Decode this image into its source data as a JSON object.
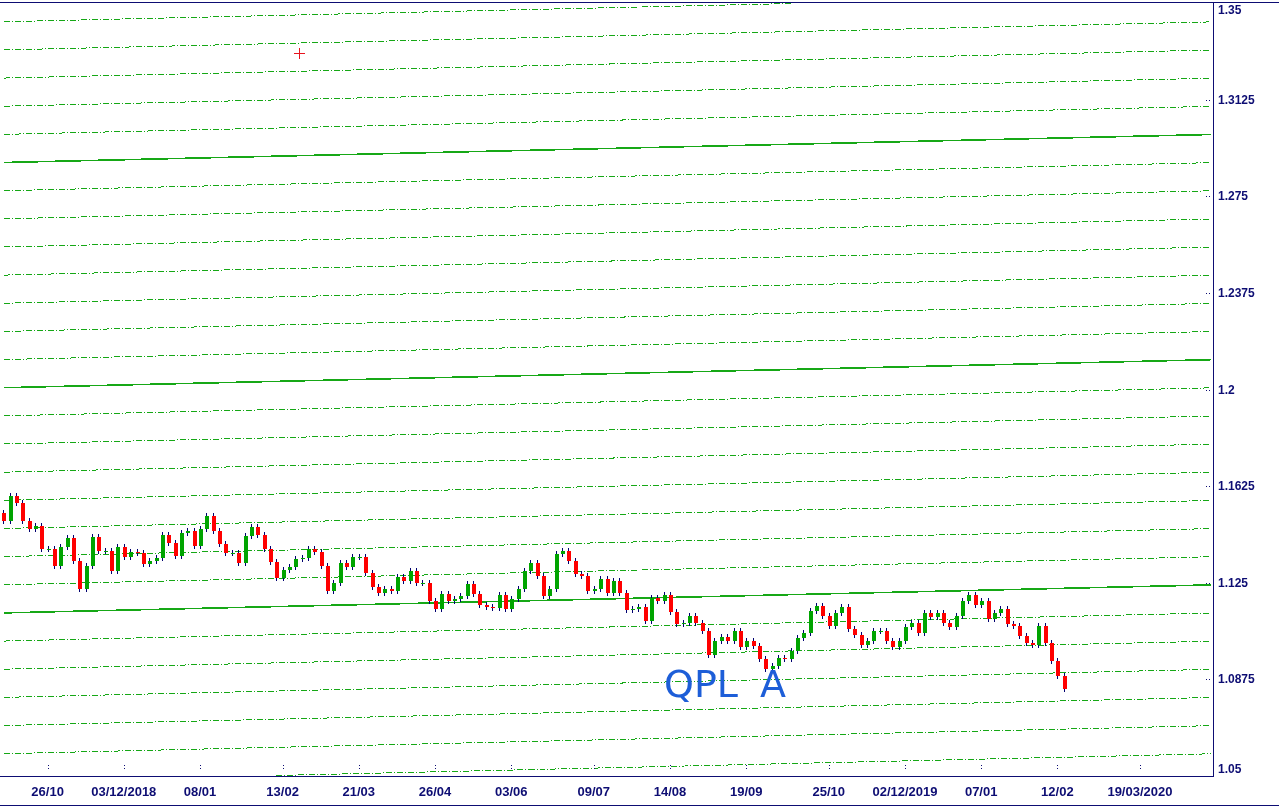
{
  "chart": {
    "chart_data": {
      "type": "candlestick",
      "ylim": [
        1.05,
        1.35
      ],
      "yticks": [
        {
          "value": 1.35,
          "label": "1.35"
        },
        {
          "value": 1.3125,
          "label": "1.3125"
        },
        {
          "value": 1.275,
          "label": "1.275"
        },
        {
          "value": 1.2375,
          "label": "1.2375"
        },
        {
          "value": 1.2,
          "label": "1.2"
        },
        {
          "value": 1.1625,
          "label": "1.1625"
        },
        {
          "value": 1.125,
          "label": "1.125"
        },
        {
          "value": 1.0875,
          "label": "1.0875"
        },
        {
          "value": 1.05,
          "label": "1.05"
        }
      ],
      "categories": [
        null,
        null,
        null,
        null,
        null,
        null,
        null,
        "26/10",
        null,
        null,
        null,
        null,
        null,
        null,
        null,
        null,
        null,
        null,
        null,
        "03/12/2018",
        null,
        null,
        null,
        null,
        null,
        null,
        null,
        null,
        null,
        null,
        null,
        "08/01",
        null,
        null,
        null,
        null,
        null,
        null,
        null,
        null,
        null,
        null,
        null,
        null,
        "13/02",
        null,
        null,
        null,
        null,
        null,
        null,
        null,
        null,
        null,
        null,
        null,
        "21/03",
        null,
        null,
        null,
        null,
        null,
        null,
        null,
        null,
        null,
        null,
        null,
        "26/04",
        null,
        null,
        null,
        null,
        null,
        null,
        null,
        null,
        null,
        null,
        null,
        "03/06",
        null,
        null,
        null,
        null,
        null,
        null,
        null,
        null,
        null,
        null,
        null,
        null,
        "09/07",
        null,
        null,
        null,
        null,
        null,
        null,
        null,
        null,
        null,
        null,
        null,
        "14/08",
        null,
        null,
        null,
        null,
        null,
        null,
        null,
        null,
        null,
        null,
        null,
        "19/09",
        null,
        null,
        null,
        null,
        null,
        null,
        null,
        null,
        null,
        null,
        null,
        null,
        "25/10",
        null,
        null,
        null,
        null,
        null,
        null,
        null,
        null,
        null,
        null,
        null,
        "02/12/2019",
        null,
        null,
        null,
        null,
        null,
        null,
        null,
        null,
        null,
        null,
        null,
        "07/01",
        null,
        null,
        null,
        null,
        null,
        null,
        null,
        null,
        null,
        null,
        null,
        "12/02",
        null,
        null,
        null,
        null,
        null,
        null,
        null,
        null,
        null,
        null,
        null,
        null,
        "19/03/2020",
        null,
        null,
        null,
        null,
        null,
        null,
        null,
        null,
        null,
        null,
        null
      ],
      "ohlc": [
        [
          1.152,
          1.1532,
          1.1477,
          1.1489
        ],
        [
          1.1489,
          1.1598,
          1.1477,
          1.1586
        ],
        [
          1.1586,
          1.1598,
          1.1547,
          1.1559
        ],
        [
          1.1559,
          1.1571,
          1.1477,
          1.1489
        ],
        [
          1.1489,
          1.1501,
          1.1446,
          1.1458
        ],
        [
          1.1458,
          1.1482,
          1.1446,
          1.147
        ],
        [
          1.147,
          1.1482,
          1.1369,
          1.1381
        ],
        [
          1.1381,
          1.1393,
          1.1369,
          1.1381
        ],
        [
          1.1381,
          1.1393,
          1.1303,
          1.1315
        ],
        [
          1.1315,
          1.14,
          1.1303,
          1.1388
        ],
        [
          1.1388,
          1.1435,
          1.1376,
          1.1423
        ],
        [
          1.1423,
          1.1435,
          1.1322,
          1.1334
        ],
        [
          1.1334,
          1.1346,
          1.1214,
          1.1226
        ],
        [
          1.1226,
          1.1327,
          1.1214,
          1.1315
        ],
        [
          1.1315,
          1.1439,
          1.1303,
          1.1427
        ],
        [
          1.1427,
          1.1439,
          1.1361,
          1.1373
        ],
        [
          1.1373,
          1.1385,
          1.1361,
          1.1373
        ],
        [
          1.1373,
          1.1385,
          1.1283,
          1.1295
        ],
        [
          1.1295,
          1.14,
          1.1283,
          1.1388
        ],
        [
          1.1388,
          1.14,
          1.1338,
          1.135
        ],
        [
          1.135,
          1.1381,
          1.1338,
          1.1369
        ],
        [
          1.1369,
          1.1381,
          1.1353,
          1.1365
        ],
        [
          1.1365,
          1.1377,
          1.1311,
          1.1323
        ],
        [
          1.1323,
          1.1346,
          1.1311,
          1.1334
        ],
        [
          1.1334,
          1.1358,
          1.1322,
          1.1346
        ],
        [
          1.1346,
          1.1447,
          1.1334,
          1.1435
        ],
        [
          1.1435,
          1.1447,
          1.1392,
          1.1404
        ],
        [
          1.1404,
          1.1416,
          1.1342,
          1.1354
        ],
        [
          1.1354,
          1.1455,
          1.1342,
          1.1443
        ],
        [
          1.1443,
          1.1463,
          1.1431,
          1.1451
        ],
        [
          1.1451,
          1.1463,
          1.138,
          1.1392
        ],
        [
          1.1392,
          1.147,
          1.138,
          1.1458
        ],
        [
          1.1458,
          1.1521,
          1.1446,
          1.1509
        ],
        [
          1.1509,
          1.1521,
          1.1439,
          1.1451
        ],
        [
          1.1451,
          1.1463,
          1.1388,
          1.14
        ],
        [
          1.14,
          1.1412,
          1.1353,
          1.1365
        ],
        [
          1.1365,
          1.1377,
          1.1353,
          1.1365
        ],
        [
          1.1365,
          1.1377,
          1.1314,
          1.1326
        ],
        [
          1.1326,
          1.1443,
          1.1314,
          1.1431
        ],
        [
          1.1431,
          1.1478,
          1.1419,
          1.1466
        ],
        [
          1.1466,
          1.1478,
          1.1423,
          1.1435
        ],
        [
          1.1435,
          1.1447,
          1.1369,
          1.1381
        ],
        [
          1.1381,
          1.1393,
          1.1318,
          1.133
        ],
        [
          1.133,
          1.1342,
          1.1256,
          1.1268
        ],
        [
          1.1268,
          1.1311,
          1.1256,
          1.1299
        ],
        [
          1.1299,
          1.1323,
          1.1287,
          1.1311
        ],
        [
          1.1311,
          1.1354,
          1.1299,
          1.1342
        ],
        [
          1.1342,
          1.1358,
          1.133,
          1.1346
        ],
        [
          1.1346,
          1.1393,
          1.1334,
          1.1381
        ],
        [
          1.1381,
          1.1393,
          1.1357,
          1.1369
        ],
        [
          1.1369,
          1.1381,
          1.1303,
          1.1315
        ],
        [
          1.1315,
          1.1327,
          1.1206,
          1.1218
        ],
        [
          1.1218,
          1.1261,
          1.1206,
          1.1249
        ],
        [
          1.1249,
          1.1338,
          1.1237,
          1.1326
        ],
        [
          1.1326,
          1.1338,
          1.1299,
          1.1311
        ],
        [
          1.1311,
          1.1362,
          1.1299,
          1.135
        ],
        [
          1.135,
          1.1362,
          1.1338,
          1.135
        ],
        [
          1.135,
          1.1362,
          1.1276,
          1.1288
        ],
        [
          1.1288,
          1.13,
          1.1221,
          1.1233
        ],
        [
          1.1233,
          1.1245,
          1.1198,
          1.121
        ],
        [
          1.121,
          1.1238,
          1.1198,
          1.1226
        ],
        [
          1.1226,
          1.1238,
          1.1206,
          1.1218
        ],
        [
          1.1218,
          1.1284,
          1.1206,
          1.1272
        ],
        [
          1.1272,
          1.1284,
          1.1245,
          1.1257
        ],
        [
          1.1257,
          1.1307,
          1.1245,
          1.1295
        ],
        [
          1.1295,
          1.1307,
          1.1237,
          1.1249
        ],
        [
          1.1249,
          1.1261,
          1.1237,
          1.1249
        ],
        [
          1.1249,
          1.1261,
          1.1167,
          1.1179
        ],
        [
          1.1179,
          1.1191,
          1.1136,
          1.1148
        ],
        [
          1.1148,
          1.1218,
          1.1136,
          1.1206
        ],
        [
          1.1206,
          1.1218,
          1.1167,
          1.1179
        ],
        [
          1.1179,
          1.1199,
          1.1167,
          1.1187
        ],
        [
          1.1187,
          1.121,
          1.1175,
          1.1198
        ],
        [
          1.1198,
          1.1257,
          1.1186,
          1.1245
        ],
        [
          1.1245,
          1.1257,
          1.1194,
          1.1206
        ],
        [
          1.1206,
          1.1218,
          1.1152,
          1.1164
        ],
        [
          1.1164,
          1.1176,
          1.1144,
          1.1156
        ],
        [
          1.1156,
          1.1168,
          1.114,
          1.1152
        ],
        [
          1.1152,
          1.1214,
          1.114,
          1.1202
        ],
        [
          1.1202,
          1.1214,
          1.1136,
          1.1148
        ],
        [
          1.1148,
          1.1199,
          1.1136,
          1.1187
        ],
        [
          1.1187,
          1.1238,
          1.1175,
          1.1226
        ],
        [
          1.1226,
          1.1307,
          1.1214,
          1.1295
        ],
        [
          1.1295,
          1.1338,
          1.1283,
          1.1326
        ],
        [
          1.1326,
          1.1338,
          1.1264,
          1.1276
        ],
        [
          1.1276,
          1.1288,
          1.1186,
          1.1198
        ],
        [
          1.1198,
          1.1238,
          1.1186,
          1.1226
        ],
        [
          1.1226,
          1.1373,
          1.1214,
          1.1361
        ],
        [
          1.1361,
          1.1385,
          1.1349,
          1.1373
        ],
        [
          1.1373,
          1.1385,
          1.1322,
          1.1334
        ],
        [
          1.1334,
          1.1346,
          1.1272,
          1.1284
        ],
        [
          1.1284,
          1.1296,
          1.1264,
          1.1276
        ],
        [
          1.1276,
          1.1288,
          1.1206,
          1.1218
        ],
        [
          1.1218,
          1.1238,
          1.1206,
          1.1226
        ],
        [
          1.1226,
          1.1276,
          1.1214,
          1.1264
        ],
        [
          1.1264,
          1.1276,
          1.1198,
          1.121
        ],
        [
          1.121,
          1.1269,
          1.1198,
          1.1257
        ],
        [
          1.1257,
          1.1269,
          1.1198,
          1.121
        ],
        [
          1.121,
          1.1222,
          1.1132,
          1.1144
        ],
        [
          1.1144,
          1.116,
          1.1132,
          1.1148
        ],
        [
          1.1148,
          1.1168,
          1.1136,
          1.1156
        ],
        [
          1.1156,
          1.1168,
          1.1089,
          1.1101
        ],
        [
          1.1101,
          1.1203,
          1.1089,
          1.1191
        ],
        [
          1.1191,
          1.1203,
          1.1167,
          1.1179
        ],
        [
          1.1179,
          1.1214,
          1.1167,
          1.1202
        ],
        [
          1.1202,
          1.1214,
          1.1125,
          1.1137
        ],
        [
          1.1137,
          1.1149,
          1.1078,
          1.109
        ],
        [
          1.109,
          1.1106,
          1.1078,
          1.1094
        ],
        [
          1.1094,
          1.1133,
          1.1082,
          1.1121
        ],
        [
          1.1121,
          1.1133,
          1.1082,
          1.1094
        ],
        [
          1.1094,
          1.1106,
          1.1051,
          1.1063
        ],
        [
          1.1063,
          1.1075,
          1.0958,
          1.097
        ],
        [
          1.097,
          1.1036,
          1.0958,
          1.1024
        ],
        [
          1.1024,
          1.1051,
          1.1012,
          1.1039
        ],
        [
          1.1039,
          1.1051,
          1.1012,
          1.1024
        ],
        [
          1.1024,
          1.1075,
          1.1012,
          1.1063
        ],
        [
          1.1063,
          1.1075,
          1.0989,
          1.1001
        ],
        [
          1.1001,
          1.1036,
          1.0989,
          1.1024
        ],
        [
          1.1024,
          1.1036,
          1.0992,
          1.1004
        ],
        [
          1.1004,
          1.1016,
          1.0942,
          1.0954
        ],
        [
          1.0954,
          1.0966,
          1.0903,
          1.0915
        ],
        [
          1.0915,
          1.0939,
          1.0903,
          1.0927
        ],
        [
          1.0927,
          1.097,
          1.0915,
          1.0958
        ],
        [
          1.0958,
          1.097,
          1.0942,
          1.0954
        ],
        [
          1.0954,
          1.0997,
          1.0942,
          1.0985
        ],
        [
          1.0985,
          1.1047,
          1.0973,
          1.1035
        ],
        [
          1.1035,
          1.1067,
          1.1023,
          1.1055
        ],
        [
          1.1055,
          1.1152,
          1.1043,
          1.114
        ],
        [
          1.114,
          1.1172,
          1.1128,
          1.116
        ],
        [
          1.116,
          1.1172,
          1.1109,
          1.1121
        ],
        [
          1.1121,
          1.1133,
          1.107,
          1.1082
        ],
        [
          1.1082,
          1.1145,
          1.107,
          1.1133
        ],
        [
          1.1133,
          1.1168,
          1.1121,
          1.1156
        ],
        [
          1.1156,
          1.1168,
          1.1059,
          1.1071
        ],
        [
          1.1071,
          1.1083,
          1.1035,
          1.1047
        ],
        [
          1.1047,
          1.1059,
          1.0996,
          1.1008
        ],
        [
          1.1008,
          1.1036,
          1.0996,
          1.1024
        ],
        [
          1.1024,
          1.1075,
          1.1012,
          1.1063
        ],
        [
          1.1063,
          1.1075,
          1.1051,
          1.1063
        ],
        [
          1.1063,
          1.1075,
          1.1012,
          1.1024
        ],
        [
          1.1024,
          1.1036,
          1.0989,
          1.1001
        ],
        [
          1.1001,
          1.1036,
          1.0989,
          1.1024
        ],
        [
          1.1024,
          1.109,
          1.1012,
          1.1078
        ],
        [
          1.1078,
          1.1106,
          1.1066,
          1.1094
        ],
        [
          1.1094,
          1.1106,
          1.1043,
          1.1055
        ],
        [
          1.1055,
          1.1145,
          1.1043,
          1.1133
        ],
        [
          1.1133,
          1.1145,
          1.1105,
          1.1117
        ],
        [
          1.1117,
          1.1145,
          1.1105,
          1.1133
        ],
        [
          1.1133,
          1.1145,
          1.1082,
          1.1094
        ],
        [
          1.1094,
          1.1106,
          1.1066,
          1.1078
        ],
        [
          1.1078,
          1.1133,
          1.1066,
          1.1121
        ],
        [
          1.1121,
          1.1191,
          1.1109,
          1.1179
        ],
        [
          1.1179,
          1.1214,
          1.1167,
          1.1202
        ],
        [
          1.1202,
          1.1214,
          1.1152,
          1.1164
        ],
        [
          1.1164,
          1.1191,
          1.1152,
          1.1179
        ],
        [
          1.1179,
          1.1191,
          1.1097,
          1.1109
        ],
        [
          1.1109,
          1.1145,
          1.1097,
          1.1133
        ],
        [
          1.1133,
          1.116,
          1.1121,
          1.1148
        ],
        [
          1.1148,
          1.116,
          1.1078,
          1.109
        ],
        [
          1.109,
          1.1102,
          1.107,
          1.1082
        ],
        [
          1.1082,
          1.1094,
          1.1031,
          1.1043
        ],
        [
          1.1043,
          1.1055,
          1.1004,
          1.1016
        ],
        [
          1.1016,
          1.1028,
          1.0996,
          1.1008
        ],
        [
          1.1008,
          1.1094,
          1.0996,
          1.1082
        ],
        [
          1.1082,
          1.1094,
          1.1004,
          1.1016
        ],
        [
          1.1016,
          1.1028,
          1.0934,
          1.0946
        ],
        [
          1.0946,
          1.0958,
          1.0876,
          1.0888
        ],
        [
          1.0888,
          1.09,
          1.0826,
          1.0838
        ],
        null,
        null,
        null,
        null,
        null,
        null,
        null,
        null,
        null,
        null,
        null,
        null,
        null,
        null,
        null,
        null,
        null,
        null,
        null,
        null,
        null,
        null,
        null
      ],
      "annotations": [
        "QPL A"
      ]
    }
  }
}
